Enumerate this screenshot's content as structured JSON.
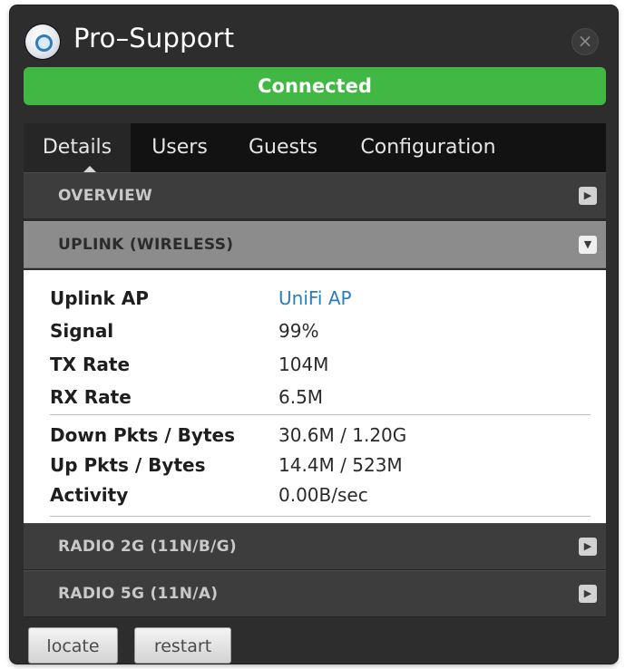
{
  "window": {
    "title": "Pro–Support",
    "close_glyph": "×"
  },
  "status": {
    "text": "Connected",
    "color": "#41b844"
  },
  "tabs": [
    {
      "label": "Details",
      "active": true
    },
    {
      "label": "Users",
      "active": false
    },
    {
      "label": "Guests",
      "active": false
    },
    {
      "label": "Configuration",
      "active": false
    }
  ],
  "sections": {
    "overview": {
      "label": "OVERVIEW",
      "glyph": "▶"
    },
    "uplink": {
      "label": "UPLINK (WIRELESS)",
      "glyph": "▼"
    },
    "radio2g": {
      "label": "RADIO 2G (11N/B/G)",
      "glyph": "▶"
    },
    "radio5g": {
      "label": "RADIO 5G (11N/A)",
      "glyph": "▶"
    }
  },
  "uplink": {
    "ap": {
      "label": "Uplink  AP",
      "value": "UniFi AP"
    },
    "signal": {
      "label": "Signal",
      "value": "99%"
    },
    "tx": {
      "label": "TX Rate",
      "value": "104M"
    },
    "rx": {
      "label": "RX Rate",
      "value": "6.5M"
    },
    "down": {
      "label": "Down Pkts / Bytes",
      "value": "30.6M / 1.20G"
    },
    "up": {
      "label": "Up Pkts / Bytes",
      "value": "14.4M / 523M"
    },
    "activity": {
      "label": "Activity",
      "value": "0.00B/sec"
    }
  },
  "actions": {
    "locate": "locate",
    "restart": "restart"
  }
}
